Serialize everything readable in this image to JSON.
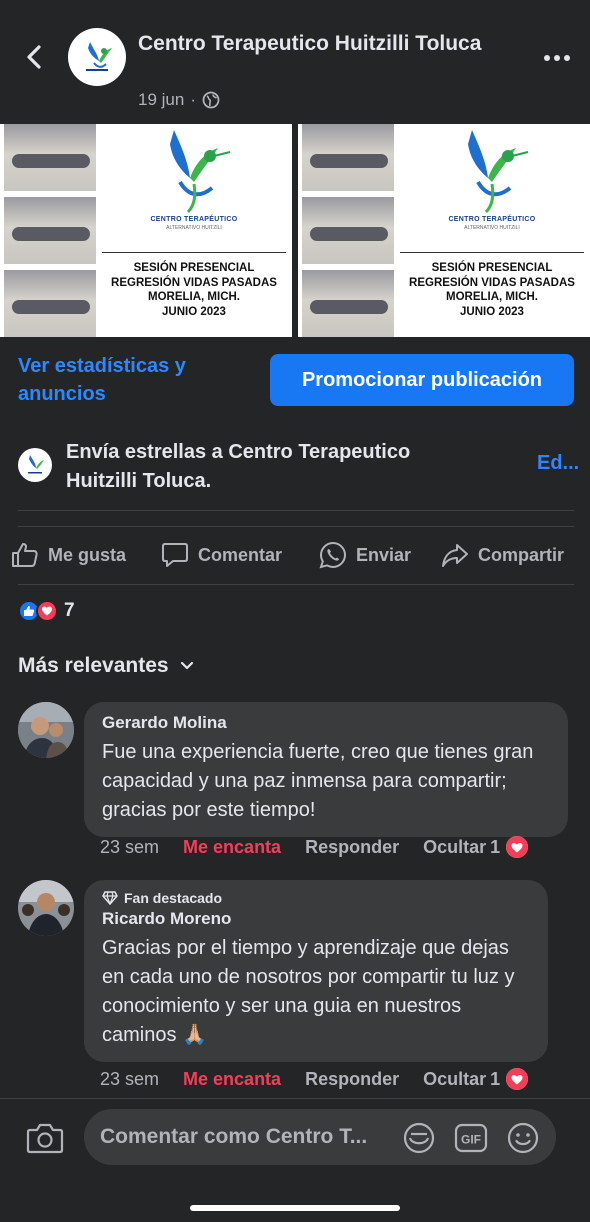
{
  "header": {
    "page_name": "Centro Terapeutico Huitzilli Toluca",
    "date": "19 jun",
    "separator": "·",
    "back_icon": "chevron-left-icon",
    "more_icon": "more-horizontal-icon",
    "privacy_icon": "globe-icon"
  },
  "post": {
    "images": [
      {
        "brand": "CENTRO TERAPÉUTICO",
        "brand_sub": "ALTERNATIVO HUITZILI",
        "caption_lines": [
          "SESIÓN PRESENCIAL",
          "REGRESIÓN VIDAS PASADAS",
          "MORELIA, MICH.",
          "JUNIO 2023"
        ]
      },
      {
        "brand": "CENTRO TERAPÉUTICO",
        "brand_sub": "ALTERNATIVO HUITZILI",
        "caption_lines": [
          "SESIÓN PRESENCIAL",
          "REGRESIÓN VIDAS PASADAS",
          "MORELIA, MICH.",
          "JUNIO 2023"
        ]
      }
    ]
  },
  "insights": {
    "stats_link": "Ver estadísticas y anuncios",
    "promote_button": "Promocionar publicación"
  },
  "stars": {
    "text": "Envía estrellas a Centro Terapeutico Huitzilli Toluca.",
    "edit": "Ed..."
  },
  "actions": {
    "like": "Me gusta",
    "comment": "Comentar",
    "send": "Enviar",
    "share": "Compartir"
  },
  "reactions": {
    "count": "7",
    "types": [
      "like",
      "love"
    ]
  },
  "sort": {
    "label": "Más relevantes"
  },
  "comments": [
    {
      "author": "Gerardo Molina",
      "text": "Fue una experiencia fuerte, creo que tienes gran capacidad y una paz inmensa para compartir; gracias por este tiempo!",
      "time": "23 sem",
      "reaction_label": "Me encanta",
      "reply": "Responder",
      "hide": "Ocultar",
      "reaction_count": "1"
    },
    {
      "badge": "Fan destacado",
      "author": "Ricardo Moreno",
      "text": "Gracias por el tiempo y aprendizaje que dejas en cada uno de nosotros por compartir tu luz y conocimiento y ser una guia en nuestros caminos 🙏🏼",
      "time": "23 sem",
      "reaction_label": "Me encanta",
      "reply": "Responder",
      "hide": "Ocultar",
      "reaction_count": "1"
    }
  ],
  "composer": {
    "placeholder": "Comentar como Centro T...",
    "camera_icon": "camera-icon",
    "sticker_icon": "sticker-icon",
    "gif_label": "GIF",
    "emoji_icon": "emoji-icon"
  },
  "colors": {
    "background": "#242526",
    "accent": "#2d88ff",
    "button": "#1877f2",
    "love": "#f33e58"
  }
}
